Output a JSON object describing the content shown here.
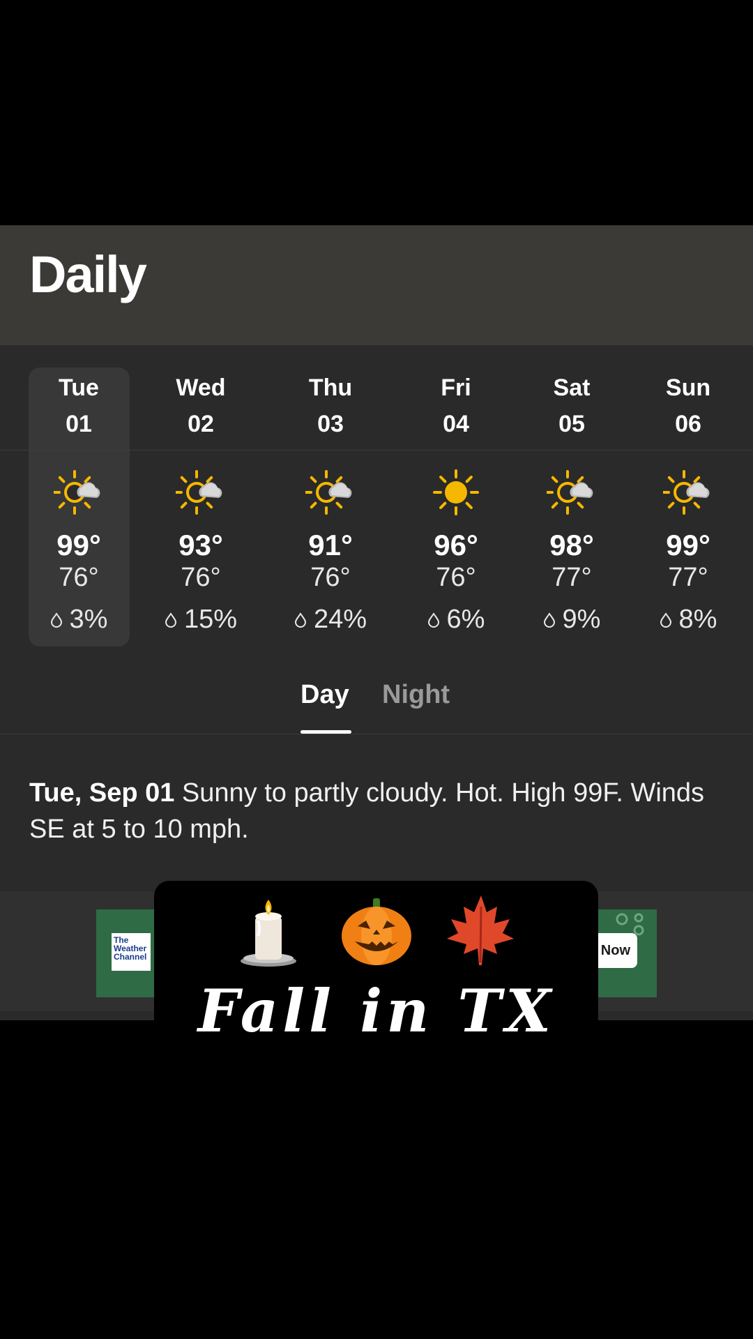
{
  "header": {
    "title": "Daily"
  },
  "days": [
    {
      "name": "Tue",
      "date": "01",
      "icon": "partly-cloudy-sun-icon",
      "high": "99°",
      "low": "76°",
      "precip": "3%",
      "selected": true
    },
    {
      "name": "Wed",
      "date": "02",
      "icon": "partly-cloudy-sun-icon",
      "high": "93°",
      "low": "76°",
      "precip": "15%"
    },
    {
      "name": "Thu",
      "date": "03",
      "icon": "partly-cloudy-sun-icon",
      "high": "91°",
      "low": "76°",
      "precip": "24%"
    },
    {
      "name": "Fri",
      "date": "04",
      "icon": "sun-icon",
      "high": "96°",
      "low": "76°",
      "precip": "6%"
    },
    {
      "name": "Sat",
      "date": "05",
      "icon": "partly-cloudy-sun-icon",
      "high": "98°",
      "low": "77°",
      "precip": "9%"
    },
    {
      "name": "Sun",
      "date": "06",
      "icon": "partly-cloudy-sun-icon",
      "high": "99°",
      "low": "77°",
      "precip": "8%"
    }
  ],
  "tabs": {
    "day": "Day",
    "night": "Night",
    "active": "day"
  },
  "narrative": {
    "date": "Tue, Sep 01",
    "text": " Sunny to partly cloudy. Hot. High 99F. Winds SE at 5 to 10 mph."
  },
  "ad": {
    "logo_text": "The Weather Channel",
    "button_label": "Now",
    "background": "#2f6b45"
  },
  "overlay": {
    "emojis": [
      "candle-icon",
      "jack-o-lantern-icon",
      "maple-leaf-icon"
    ],
    "caption": "Fall in TX"
  },
  "colors": {
    "sun": "#f5b800",
    "panel": "#2a2a2a",
    "header": "#3c3a36"
  }
}
